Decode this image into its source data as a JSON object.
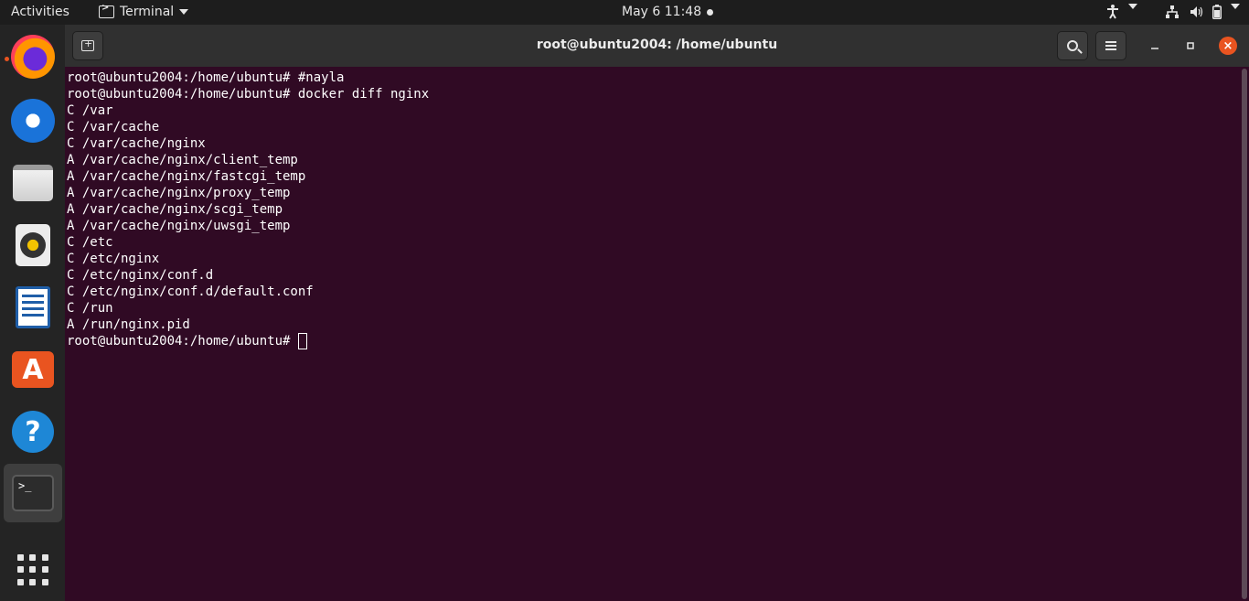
{
  "topbar": {
    "activities": "Activities",
    "app_menu": "Terminal",
    "clock": "May 6  11:48"
  },
  "dock": {
    "items": [
      "firefox-icon",
      "thunderbird-icon",
      "files-icon",
      "rhythmbox-icon",
      "libreoffice-writer-icon",
      "ubuntu-software-icon",
      "help-icon",
      "terminal-icon",
      "show-applications-icon"
    ]
  },
  "window": {
    "title": "root@ubuntu2004: /home/ubuntu",
    "accent": "#e95420"
  },
  "terminal": {
    "background": "#300a24",
    "lines": [
      "root@ubuntu2004:/home/ubuntu# #nayla",
      "root@ubuntu2004:/home/ubuntu# docker diff nginx",
      "C /var",
      "C /var/cache",
      "C /var/cache/nginx",
      "A /var/cache/nginx/client_temp",
      "A /var/cache/nginx/fastcgi_temp",
      "A /var/cache/nginx/proxy_temp",
      "A /var/cache/nginx/scgi_temp",
      "A /var/cache/nginx/uwsgi_temp",
      "C /etc",
      "C /etc/nginx",
      "C /etc/nginx/conf.d",
      "C /etc/nginx/conf.d/default.conf",
      "C /run",
      "A /run/nginx.pid"
    ],
    "prompt": "root@ubuntu2004:/home/ubuntu# "
  }
}
